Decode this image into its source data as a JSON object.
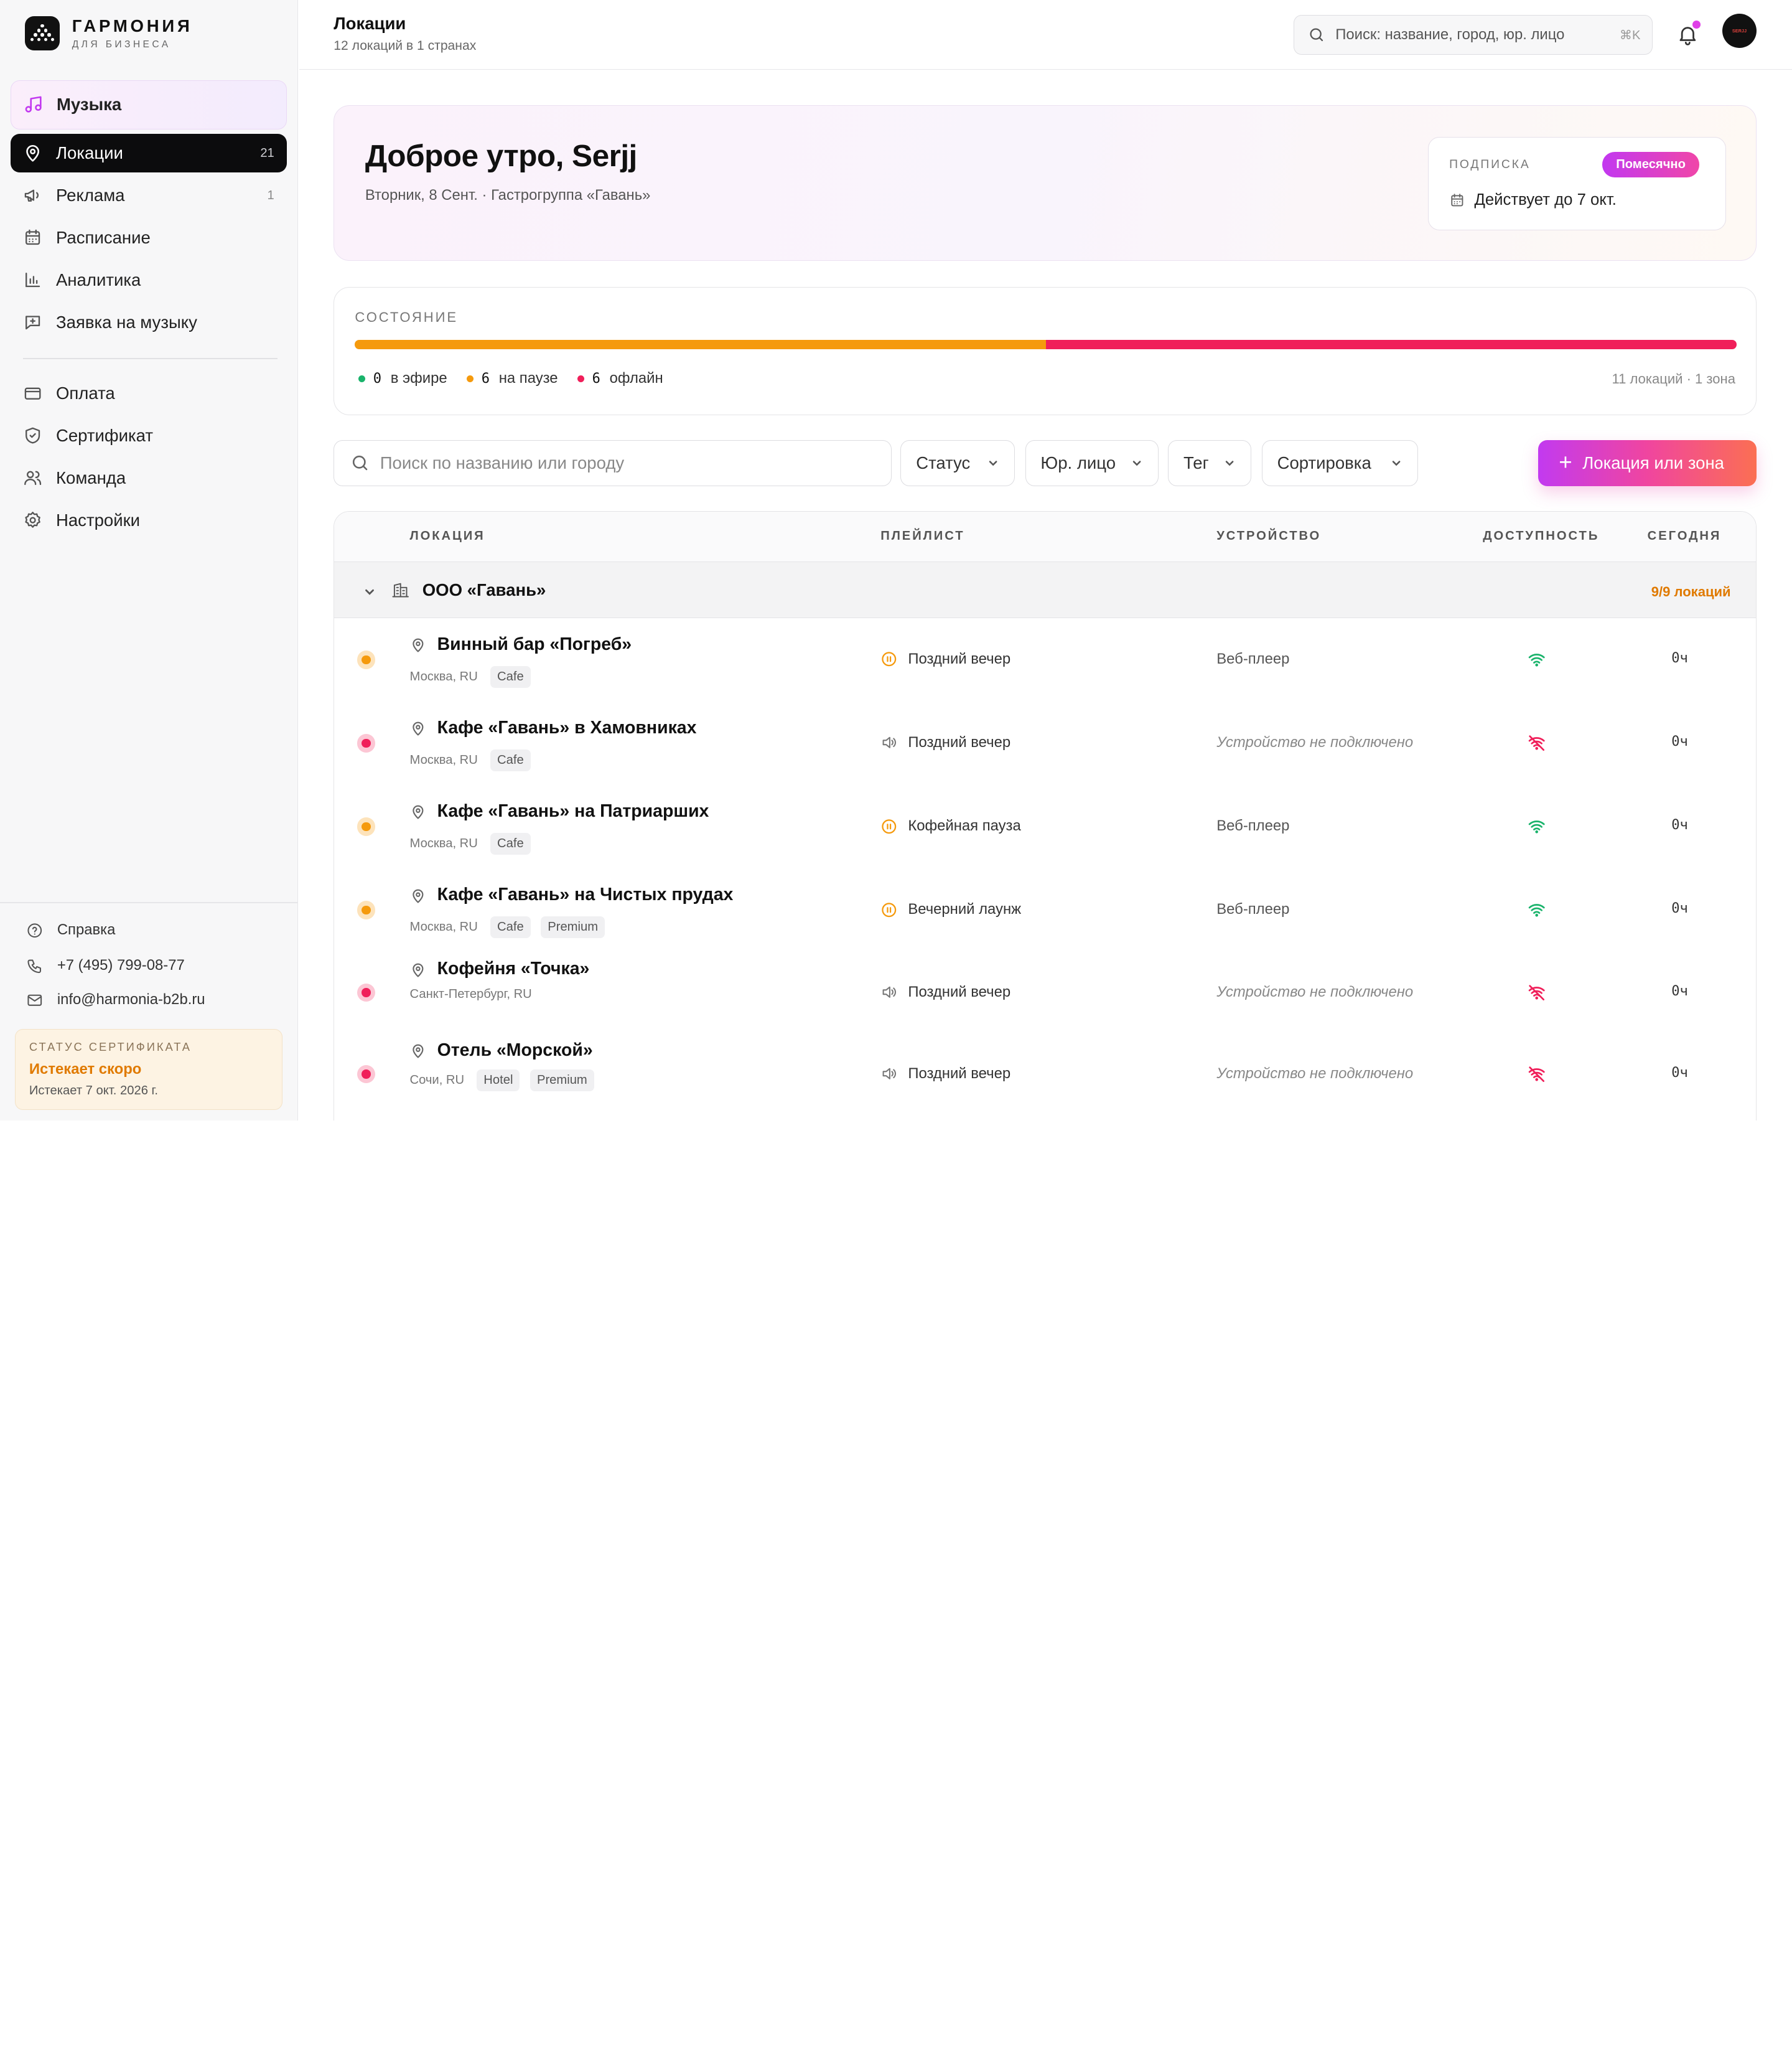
{
  "brand": {
    "name": "ГАРМОНИЯ",
    "sub": "ДЛЯ БИЗНЕСА"
  },
  "sidebar": {
    "music": "Музыка",
    "items": [
      {
        "label": "Локации",
        "count": "21",
        "icon": "map-pin-icon"
      },
      {
        "label": "Реклама",
        "count": "1",
        "icon": "megaphone-icon"
      },
      {
        "label": "Расписание",
        "count": "",
        "icon": "calendar-icon"
      },
      {
        "label": "Аналитика",
        "count": "",
        "icon": "bar-chart-icon"
      },
      {
        "label": "Заявка на музыку",
        "count": "",
        "icon": "request-icon"
      }
    ],
    "items2": [
      {
        "label": "Оплата",
        "icon": "credit-card-icon"
      },
      {
        "label": "Сертификат",
        "icon": "shield-icon"
      },
      {
        "label": "Команда",
        "icon": "users-icon"
      },
      {
        "label": "Настройки",
        "icon": "gear-icon"
      }
    ],
    "footer": {
      "help": "Справка",
      "phone": "+7 (495) 799-08-77",
      "email": "info@harmonia-b2b.ru"
    },
    "cert": {
      "caption": "СТАТУС СЕРТИФИКАТА",
      "status": "Истекает скоро",
      "date": "Истекает 7 окт. 2026 г."
    }
  },
  "header": {
    "title": "Локации",
    "subtitle": "12 локаций в 1 странах",
    "search_placeholder": "Поиск: название, город, юр. лицо",
    "search_shortcut": "⌘K",
    "avatar_text": "SERJJ"
  },
  "greeting": {
    "title": "Доброе утро, Serjj",
    "subtitle": "Вторник, 8 Сент. · Гастрогруппа «Гавань»",
    "subscription": {
      "caption": "ПОДПИСКА",
      "badge": "Помесячно",
      "valid": "Действует до 7 окт."
    }
  },
  "status": {
    "caption": "СОСТОЯНИЕ",
    "on_air": {
      "count": "0",
      "label": "в эфире",
      "share": 0
    },
    "paused": {
      "count": "6",
      "label": "на паузе",
      "share": 0.5
    },
    "offline": {
      "count": "6",
      "label": "офлайн",
      "share": 0.5
    },
    "meta": "11 локаций · 1 зона",
    "colors": {
      "on_air": "#19b36b",
      "paused": "#f59a0d",
      "offline": "#f01f5a"
    }
  },
  "toolbar": {
    "search_placeholder": "Поиск по названию или городу",
    "filters": [
      "Статус",
      "Юр. лицо",
      "Тег",
      "Сортировка"
    ],
    "add_label": "Локация или зона"
  },
  "table": {
    "columns": [
      "ЛОКАЦИЯ",
      "ПЛЕЙЛИСТ",
      "УСТРОЙСТВО",
      "ДОСТУПНОСТЬ",
      "СЕГОДНЯ"
    ],
    "group": {
      "name": "ООО «Гавань»",
      "count": "9/9 локаций"
    },
    "rows": [
      {
        "status": "paused",
        "name": "Винный бар «Погреб»",
        "city": "Москва, RU",
        "tags": [
          "Cafe"
        ],
        "playlist": "Поздний вечер",
        "playlist_state": "pause",
        "device": "Веб-плеер",
        "online": true,
        "today": "0ч"
      },
      {
        "status": "offline",
        "name": "Кафе «Гавань» в Хамовниках",
        "city": "Москва, RU",
        "tags": [
          "Cafe"
        ],
        "playlist": "Поздний вечер",
        "playlist_state": "speaker",
        "device": "Устройство не подключено",
        "online": false,
        "today": "0ч"
      },
      {
        "status": "paused",
        "name": "Кафе «Гавань» на Патриарших",
        "city": "Москва, RU",
        "tags": [
          "Cafe"
        ],
        "playlist": "Кофейная пауза",
        "playlist_state": "pause",
        "device": "Веб-плеер",
        "online": true,
        "today": "0ч"
      },
      {
        "status": "paused",
        "name": "Кафе «Гавань» на Чистых прудах",
        "city": "Москва, RU",
        "tags": [
          "Cafe",
          "Premium"
        ],
        "playlist": "Вечерний лаунж",
        "playlist_state": "pause",
        "device": "Веб-плеер",
        "online": true,
        "today": "0ч"
      },
      {
        "status": "offline",
        "name": "Кофейня «Точка»",
        "city": "Санкт-Петербург, RU",
        "tags": [],
        "playlist": "Поздний вечер",
        "playlist_state": "speaker",
        "device": "Устройство не подключено",
        "online": false,
        "today": "0ч"
      },
      {
        "status": "offline",
        "name": "Отель «Морской»",
        "city": "Сочи, RU",
        "tags": [
          "Hotel",
          "Premium"
        ],
        "playlist": "Поздний вечер",
        "playlist_state": "speaker",
        "device": "Устройство не подключено",
        "online": false,
        "today": "0ч"
      }
    ]
  }
}
